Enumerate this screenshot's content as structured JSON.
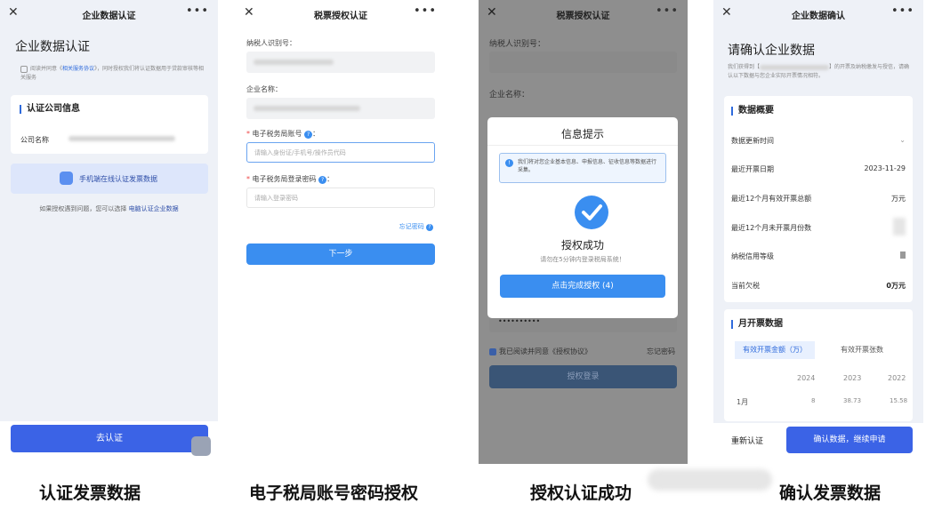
{
  "screen1": {
    "nav_title": "企业数据认证",
    "heading": "企业数据认证",
    "agree_prefix": "阅读并同意《",
    "agree_link": "相关服务协议",
    "agree_suffix": "》，同时授权我们将认证数据用于贷款审核等相关服务",
    "section_title": "认证公司信息",
    "company_label": "公司名称",
    "scan_label": "手机端在线认证发票数据",
    "tip_prefix": "如果授权遇到问题，您可以选择 ",
    "tip_link": "电脑认证企业数据",
    "button": "去认证",
    "caption": "认证发票数据"
  },
  "screen2": {
    "nav_title": "税票授权认证",
    "taxpayer_label": "纳税人识别号：",
    "company_label": "企业名称：",
    "account_label": "电子税务局账号",
    "account_placeholder": "请输入身份证/手机号/操作员代码",
    "password_label": "电子税务局登录密码",
    "password_placeholder": "请输入登录密码",
    "forgot": "忘记密码",
    "next_button": "下一步",
    "caption": "电子税局账号密码授权"
  },
  "screen3": {
    "nav_title": "税票授权认证",
    "bg_taxpayer_label": "纳税人识别号：",
    "bg_company_label": "企业名称：",
    "modal_title": "信息提示",
    "modal_notice": "我们将对您企业基本信息、申报信息、征收信息等数据进行采集。",
    "success_title": "授权成功",
    "success_sub": "请勿在5分钟内登录税局系统！",
    "confirm_button": "点击完成授权 (4)",
    "bg_password": "••••••••••",
    "bg_agree": "我已阅读并同意《授权协议》",
    "bg_forgot": "忘记密码",
    "bg_button": "授权登录",
    "caption": "授权认证成功"
  },
  "screen4": {
    "nav_title": "企业数据确认",
    "heading": "请确认企业数据",
    "intro_prefix": "我们获得到【",
    "intro_suffix": "】的开票及纳税缴发与授信，请确认以下数据与您企业实际开票情况相符。",
    "overview_title": "数据概要",
    "rows": [
      {
        "label": "数据更新时间",
        "value": ""
      },
      {
        "label": "最近开票日期",
        "value": "2023-11-29"
      },
      {
        "label": "最近12个月有效开票总额",
        "value": "万元"
      },
      {
        "label": "最近12个月未开票月份数",
        "value": ""
      },
      {
        "label": "纳税信用等级",
        "value": ""
      },
      {
        "label": "当前欠税",
        "value": "0万元"
      }
    ],
    "monthly_title": "月开票数据",
    "tab_active": "有效开票金额（万）",
    "tab_inactive": "有效开票张数",
    "years": [
      "2024",
      "2023",
      "2022"
    ],
    "month_label": "1月",
    "month_values": [
      "8",
      "38.73",
      "15.58"
    ],
    "reauth_button": "重新认证",
    "confirm_button": "确认数据，继续申请",
    "caption": "确认发票数据"
  },
  "colors": {
    "accent": "#3a8ef0",
    "deep_accent": "#2f6bdc",
    "page_bg": "#eef1f7"
  }
}
